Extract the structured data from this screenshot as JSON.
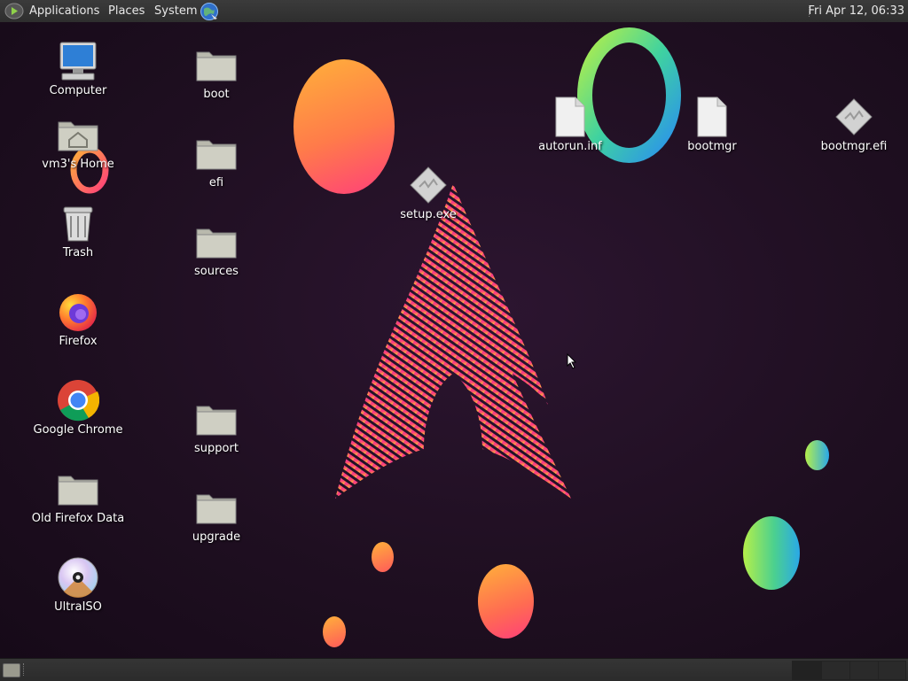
{
  "top_panel": {
    "menus": [
      "Applications",
      "Places",
      "System"
    ],
    "clock": "Fri Apr 12, 06:33",
    "icons": [
      "apps-menu-icon",
      "web-browser-icon"
    ]
  },
  "desktop": {
    "icons": [
      {
        "label": "Computer",
        "icon": "computer-icon"
      },
      {
        "label": "vm3's Home",
        "icon": "home-folder-icon"
      },
      {
        "label": "Trash",
        "icon": "trash-icon"
      },
      {
        "label": "Firefox",
        "icon": "firefox-icon"
      },
      {
        "label": "Google Chrome",
        "icon": "chrome-icon"
      },
      {
        "label": "Old Firefox Data",
        "icon": "folder-icon"
      },
      {
        "label": "UltraISO",
        "icon": "disc-icon"
      },
      {
        "label": "boot",
        "icon": "folder-icon"
      },
      {
        "label": "efi",
        "icon": "folder-icon"
      },
      {
        "label": "sources",
        "icon": "folder-icon"
      },
      {
        "label": "support",
        "icon": "folder-icon"
      },
      {
        "label": "upgrade",
        "icon": "folder-icon"
      },
      {
        "label": "setup.exe",
        "icon": "executable-icon"
      },
      {
        "label": "autorun.inf",
        "icon": "file-icon"
      },
      {
        "label": "bootmgr",
        "icon": "file-icon"
      },
      {
        "label": "bootmgr.efi",
        "icon": "executable-icon"
      }
    ]
  },
  "bottom_panel": {
    "workspaces": 4,
    "icons": [
      "show-desktop-icon"
    ]
  },
  "colors": {
    "panel": "#2e2e2e",
    "wallpaper_bg": "#1f0f21",
    "accent_orange": "#ff7b4a",
    "accent_pink": "#ff3f7a",
    "accent_green": "#4bd08f",
    "accent_blue": "#2aa8e8"
  }
}
